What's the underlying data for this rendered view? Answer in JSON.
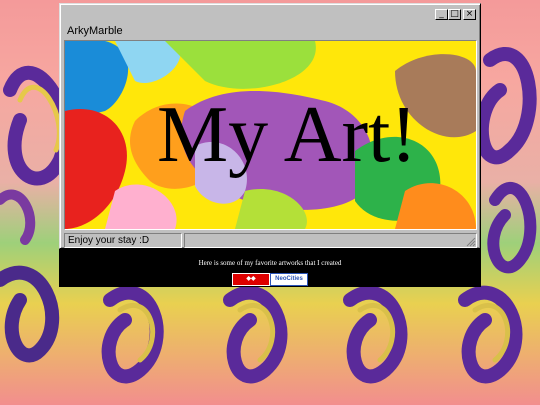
{
  "window": {
    "menu": "ArkyMarble",
    "controls": {
      "minimize": "minimize-icon",
      "maximize": "maximize-icon",
      "close": "close-icon"
    }
  },
  "artwork": {
    "heading": "My Art!"
  },
  "statusbar": {
    "text": "Enjoy your stay :D",
    "right": ""
  },
  "footer": {
    "caption": "Here is some of my favorite artworks that I created",
    "badges": [
      {
        "label": "",
        "icon": "webring-badge-icon"
      },
      {
        "label": "NeoCities",
        "icon": "neocities-badge-icon"
      }
    ]
  },
  "colors": {
    "titlebar": "#c0c0c0",
    "window_face": "#c0c0c0",
    "footer_bg": "#000000"
  }
}
